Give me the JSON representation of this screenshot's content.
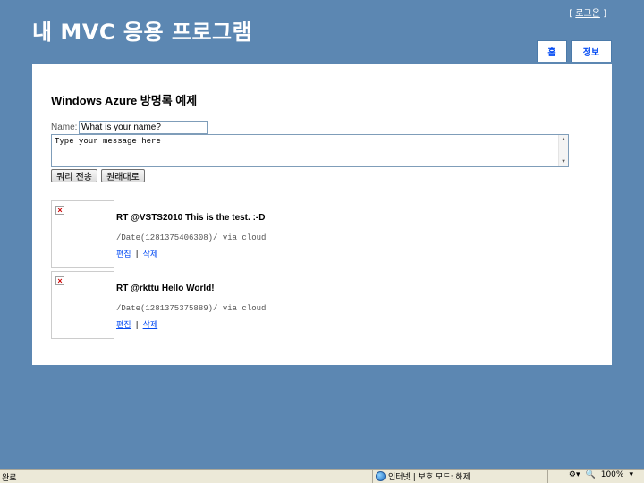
{
  "header": {
    "app_title": "내 MVC 응용 프로그램",
    "login_link": "로그온",
    "login_prefix": "[ ",
    "login_suffix": " ]"
  },
  "menu": {
    "items": [
      {
        "label": "홈"
      },
      {
        "label": "정보"
      }
    ]
  },
  "main": {
    "title": "Windows Azure 방명록 예제",
    "form": {
      "name_label": "Name:",
      "name_value": "What is your name?",
      "message_value": "Type your message here",
      "submit_label": "쿼리 전송",
      "reset_label": "원래대로"
    },
    "entries": [
      {
        "message": "RT @VSTS2010 This is the test. :-D",
        "meta": "/Date(1281375406308)/ via cloud",
        "edit_label": "편집",
        "delete_label": "삭제",
        "separator": "|"
      },
      {
        "message": "RT @rkttu Hello World!",
        "meta": "/Date(1281375375889)/ via cloud",
        "edit_label": "편집",
        "delete_label": "삭제",
        "separator": "|"
      }
    ]
  },
  "statusbar": {
    "left_text": "완료",
    "zone_text": "인터넷 | 보호 모드: 해제",
    "zoom_text": "100%"
  },
  "colors": {
    "page_background": "#5c87b2",
    "link": "#034af3",
    "content_background": "#ffffff"
  },
  "icons": {
    "broken_image": "broken-image-icon",
    "globe": "globe-icon",
    "zoom": "zoom-icon"
  }
}
